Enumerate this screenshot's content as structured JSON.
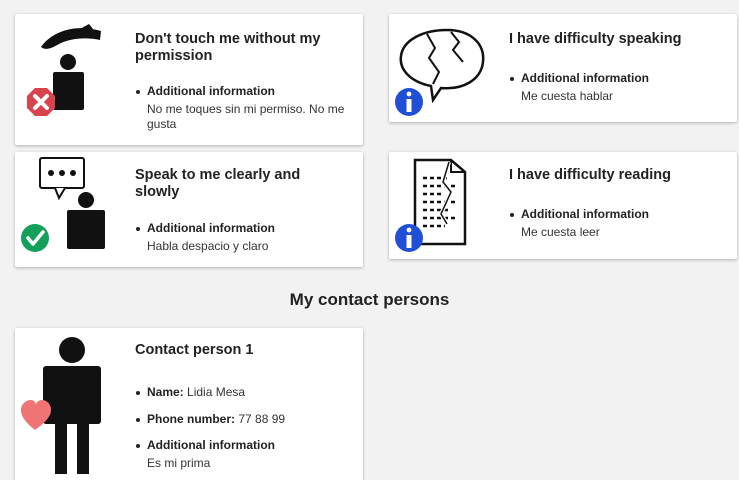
{
  "cards": [
    {
      "title": "Don't touch me without my permission",
      "info_label": "Additional information",
      "info_text": "No me toques sin mi permiso. No me gusta"
    },
    {
      "title": "I have difficulty speaking",
      "info_label": "Additional information",
      "info_text": "Me cuesta hablar"
    },
    {
      "title": "Speak to me clearly and slowly",
      "info_label": "Additional information",
      "info_text": "Habla despacio y claro"
    },
    {
      "title": "I have difficulty reading",
      "info_label": "Additional information",
      "info_text": "Me cuesta leer"
    }
  ],
  "contacts_heading": "My contact persons",
  "contact": {
    "title": "Contact person 1",
    "name_label": "Name:",
    "name_value": "Lidia Mesa",
    "phone_label": "Phone number:",
    "phone_value": "77 88 99",
    "info_label": "Additional information",
    "info_text": "Es mi prima"
  },
  "colors": {
    "deny": "#d9434e",
    "confirm": "#12a05a",
    "info": "#1f4fd6",
    "heart": "#f07475"
  }
}
